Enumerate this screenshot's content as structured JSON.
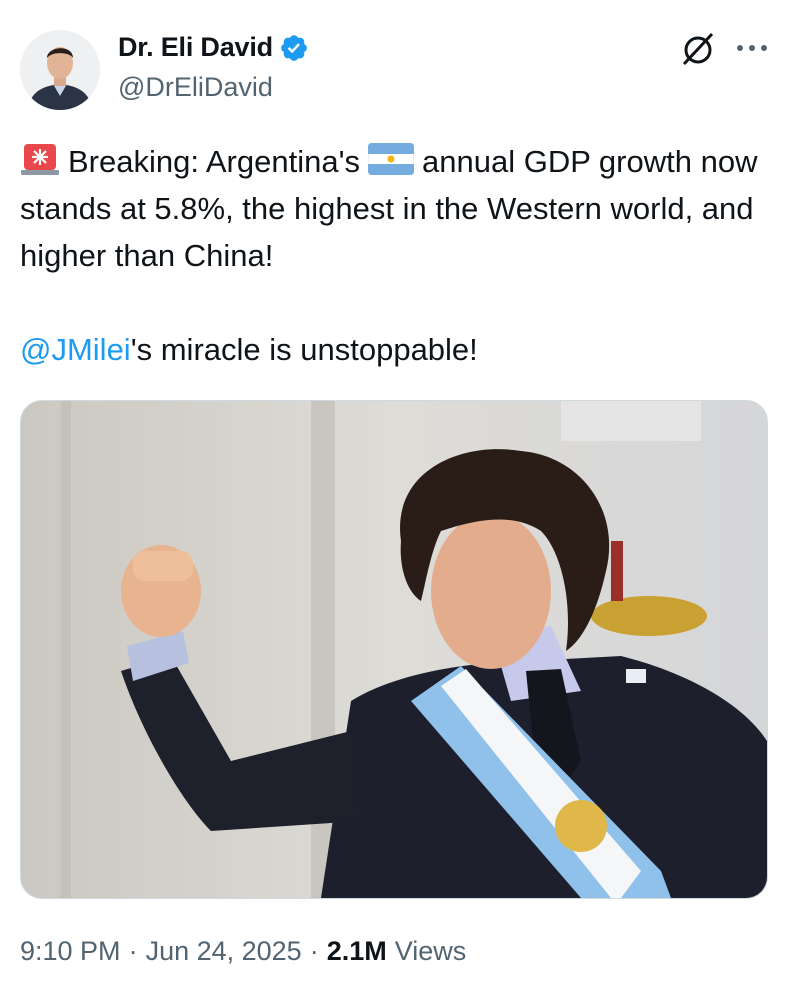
{
  "author": {
    "name": "Dr. Eli David",
    "handle": "@DrEliDavid",
    "verified": true,
    "verified_color": "#1d9bf0"
  },
  "header_icons": [
    "grok-icon",
    "more-icon"
  ],
  "tweet": {
    "line1_prefix_emoji": "rotating-light-emoji",
    "text_part1": "Breaking: Argentina's",
    "flag_emoji": "argentina-flag-emoji",
    "text_part2": "annual GDP growth now stands at 5.8%, the highest in the Western world, and higher than China!",
    "mention": "@JMilei",
    "text_part3": "'s miracle is unstoppable!",
    "mention_color": "#1d9bf0"
  },
  "media": {
    "description_icon": "photo-image"
  },
  "meta": {
    "time": "9:10 PM",
    "separator": "·",
    "date": "Jun 24, 2025",
    "views_count": "2.1M",
    "views_label": "Views"
  }
}
